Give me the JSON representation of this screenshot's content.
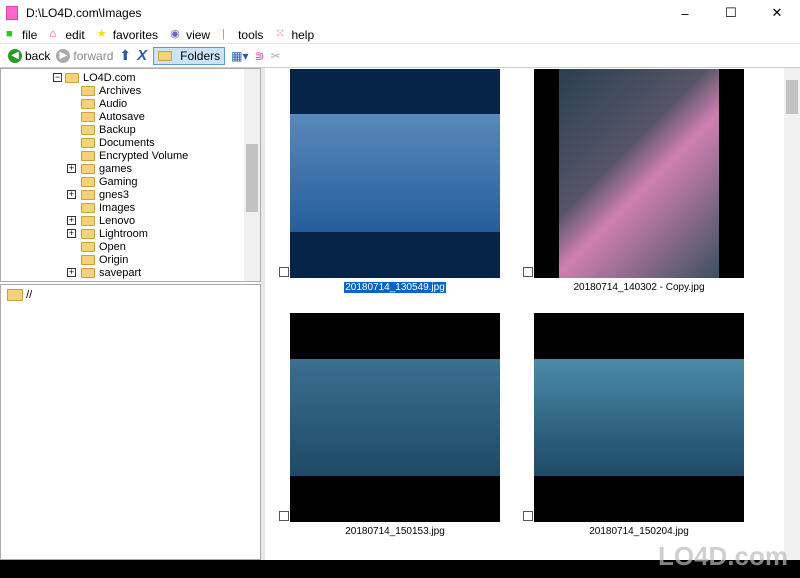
{
  "window": {
    "title": "D:\\LO4D.com\\Images",
    "controls": [
      "–",
      "☐",
      "✕"
    ]
  },
  "menu": [
    {
      "label": "file",
      "icon": "green-square",
      "color": "#22cc22"
    },
    {
      "label": "edit",
      "icon": "red-house",
      "color": "#d33"
    },
    {
      "label": "favorites",
      "icon": "star",
      "color": "#f5e000"
    },
    {
      "label": "view",
      "icon": "eye",
      "color": "#66c"
    },
    {
      "label": "tools",
      "icon": "bar",
      "color": "#f80"
    },
    {
      "label": "help",
      "icon": "dots",
      "color": "#e33"
    }
  ],
  "toolbar": {
    "back": "back",
    "forward": "forward",
    "folders": "Folders"
  },
  "tree": {
    "root": "LO4D.com",
    "items": [
      {
        "label": "Archives",
        "expand": false
      },
      {
        "label": "Audio",
        "expand": false
      },
      {
        "label": "Autosave",
        "expand": false
      },
      {
        "label": "Backup",
        "expand": false
      },
      {
        "label": "Documents",
        "expand": false
      },
      {
        "label": "Encrypted Volume",
        "expand": false
      },
      {
        "label": "games",
        "expand": true
      },
      {
        "label": "Gaming",
        "expand": false
      },
      {
        "label": "gnes3",
        "expand": true
      },
      {
        "label": "Images",
        "expand": false
      },
      {
        "label": "Lenovo",
        "expand": true
      },
      {
        "label": "Lightroom",
        "expand": true
      },
      {
        "label": "Open",
        "expand": false
      },
      {
        "label": "Origin",
        "expand": false
      },
      {
        "label": "savepart",
        "expand": true
      }
    ]
  },
  "lower_pane": {
    "path": "//"
  },
  "thumbnails": [
    {
      "name": "20180714_130549.jpg",
      "selected": true,
      "colors": [
        "#3a6a9a",
        "#9ab8d0"
      ]
    },
    {
      "name": "20180714_140302 - Copy.jpg",
      "selected": false,
      "colors": [
        "#2a4050",
        "#d080b0"
      ]
    },
    {
      "name": "20180714_150153.jpg",
      "selected": false,
      "colors": [
        "#1d4a66",
        "#3a7090"
      ]
    },
    {
      "name": "20180714_150204.jpg",
      "selected": false,
      "colors": [
        "#1d4a66",
        "#4a8aa8"
      ]
    }
  ],
  "watermark": "LO4D.com"
}
